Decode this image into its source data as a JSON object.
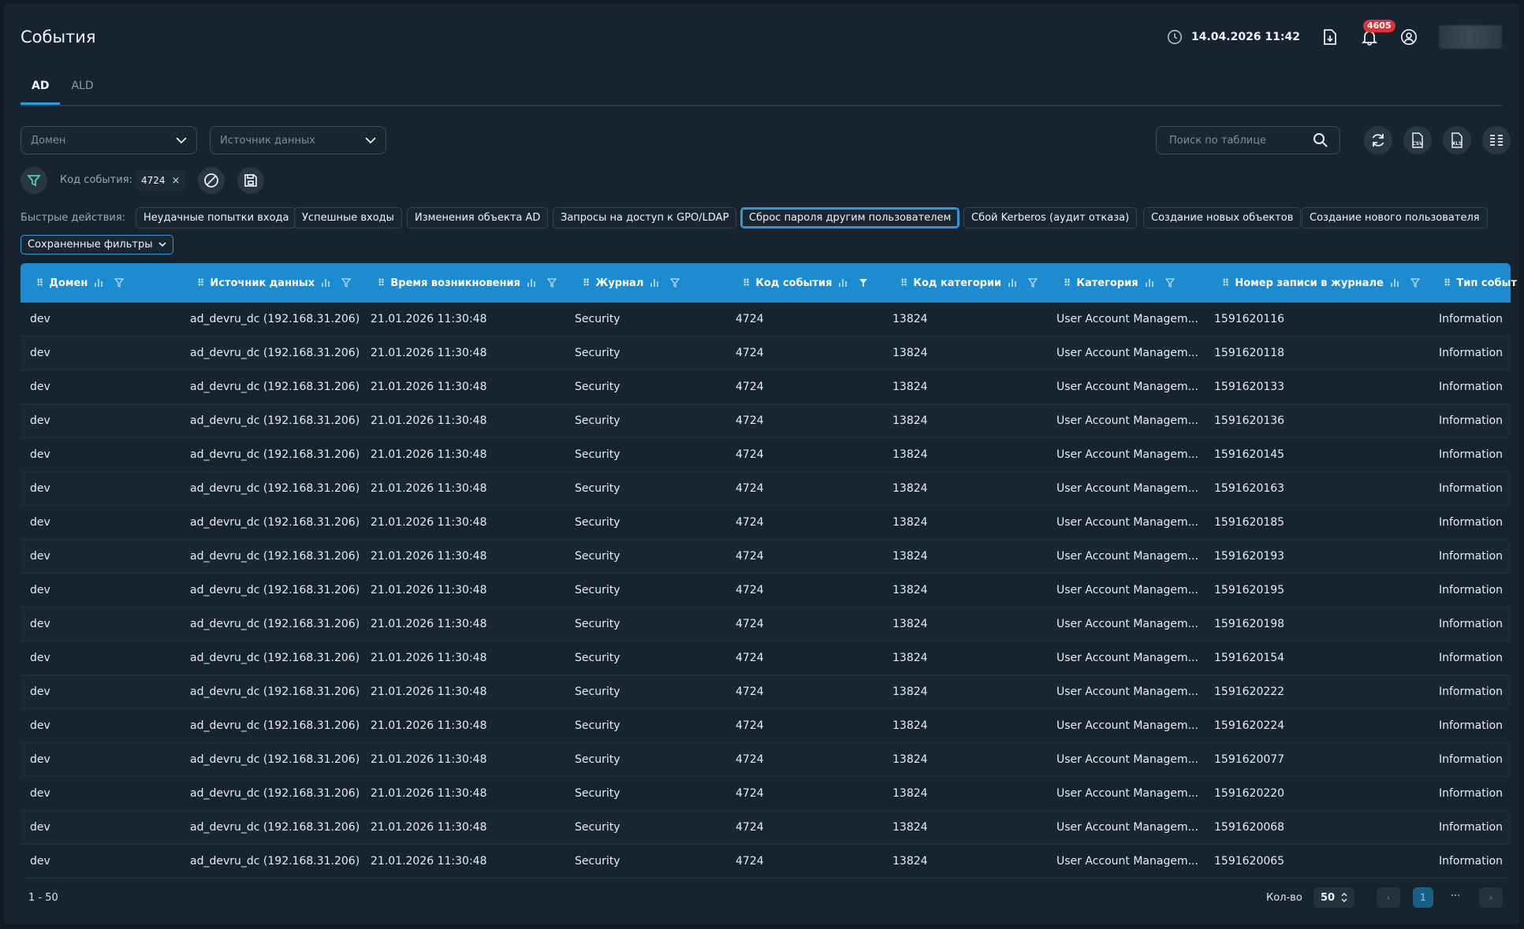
{
  "header": {
    "title": "События",
    "datetime": "14.04.2026 11:42",
    "notifications_count": "4605"
  },
  "tabs": [
    {
      "label": "AD",
      "active": true
    },
    {
      "label": "ALD",
      "active": false
    }
  ],
  "filters": {
    "domain_placeholder": "Домен",
    "source_placeholder": "Источник данных",
    "search_placeholder": "Поиск по таблице",
    "active_filter_label": "Код события:",
    "active_filter_value": "4724"
  },
  "quick_actions": {
    "label": "Быстрые действия:",
    "items": [
      "Неудачные попытки входа",
      "Успешные входы",
      "Изменения объекта AD",
      "Запросы на доступ к GPO/LDAP",
      "Сброс пароля другим пользователем",
      "Сбой Kerberos (аудит отказа)",
      "Создание новых объектов",
      "Создание нового пользователя"
    ],
    "active_index": 4,
    "saved_filters_label": "Сохраненные фильтры"
  },
  "table": {
    "columns": [
      "Домен",
      "Источник данных",
      "Время возникновения",
      "Журнал",
      "Код события",
      "Код категории",
      "Категория",
      "Номер записи в журнале",
      "Тип событ"
    ],
    "rows": [
      [
        "dev",
        "ad_devru_dc (192.168.31.206)",
        "21.01.2026 11:30:48",
        "Security",
        "4724",
        "13824",
        "User Account Managem...",
        "1591620116",
        "Information"
      ],
      [
        "dev",
        "ad_devru_dc (192.168.31.206)",
        "21.01.2026 11:30:48",
        "Security",
        "4724",
        "13824",
        "User Account Managem...",
        "1591620118",
        "Information"
      ],
      [
        "dev",
        "ad_devru_dc (192.168.31.206)",
        "21.01.2026 11:30:48",
        "Security",
        "4724",
        "13824",
        "User Account Managem...",
        "1591620133",
        "Information"
      ],
      [
        "dev",
        "ad_devru_dc (192.168.31.206)",
        "21.01.2026 11:30:48",
        "Security",
        "4724",
        "13824",
        "User Account Managem...",
        "1591620136",
        "Information"
      ],
      [
        "dev",
        "ad_devru_dc (192.168.31.206)",
        "21.01.2026 11:30:48",
        "Security",
        "4724",
        "13824",
        "User Account Managem...",
        "1591620145",
        "Information"
      ],
      [
        "dev",
        "ad_devru_dc (192.168.31.206)",
        "21.01.2026 11:30:48",
        "Security",
        "4724",
        "13824",
        "User Account Managem...",
        "1591620163",
        "Information"
      ],
      [
        "dev",
        "ad_devru_dc (192.168.31.206)",
        "21.01.2026 11:30:48",
        "Security",
        "4724",
        "13824",
        "User Account Managem...",
        "1591620185",
        "Information"
      ],
      [
        "dev",
        "ad_devru_dc (192.168.31.206)",
        "21.01.2026 11:30:48",
        "Security",
        "4724",
        "13824",
        "User Account Managem...",
        "1591620193",
        "Information"
      ],
      [
        "dev",
        "ad_devru_dc (192.168.31.206)",
        "21.01.2026 11:30:48",
        "Security",
        "4724",
        "13824",
        "User Account Managem...",
        "1591620195",
        "Information"
      ],
      [
        "dev",
        "ad_devru_dc (192.168.31.206)",
        "21.01.2026 11:30:48",
        "Security",
        "4724",
        "13824",
        "User Account Managem...",
        "1591620198",
        "Information"
      ],
      [
        "dev",
        "ad_devru_dc (192.168.31.206)",
        "21.01.2026 11:30:48",
        "Security",
        "4724",
        "13824",
        "User Account Managem...",
        "1591620154",
        "Information"
      ],
      [
        "dev",
        "ad_devru_dc (192.168.31.206)",
        "21.01.2026 11:30:48",
        "Security",
        "4724",
        "13824",
        "User Account Managem...",
        "1591620222",
        "Information"
      ],
      [
        "dev",
        "ad_devru_dc (192.168.31.206)",
        "21.01.2026 11:30:48",
        "Security",
        "4724",
        "13824",
        "User Account Managem...",
        "1591620224",
        "Information"
      ],
      [
        "dev",
        "ad_devru_dc (192.168.31.206)",
        "21.01.2026 11:30:48",
        "Security",
        "4724",
        "13824",
        "User Account Managem...",
        "1591620077",
        "Information"
      ],
      [
        "dev",
        "ad_devru_dc (192.168.31.206)",
        "21.01.2026 11:30:48",
        "Security",
        "4724",
        "13824",
        "User Account Managem...",
        "1591620220",
        "Information"
      ],
      [
        "dev",
        "ad_devru_dc (192.168.31.206)",
        "21.01.2026 11:30:48",
        "Security",
        "4724",
        "13824",
        "User Account Managem...",
        "1591620068",
        "Information"
      ],
      [
        "dev",
        "ad_devru_dc (192.168.31.206)",
        "21.01.2026 11:30:48",
        "Security",
        "4724",
        "13824",
        "User Account Managem...",
        "1591620065",
        "Information"
      ]
    ]
  },
  "footer": {
    "range": "1 - 50",
    "qty_label": "Кол-во",
    "qty_value": "50",
    "current_page": "1",
    "ellipsis": "..."
  },
  "colors": {
    "accent": "#1d8bcf",
    "background": "#17232e",
    "badge": "#d8343a"
  }
}
